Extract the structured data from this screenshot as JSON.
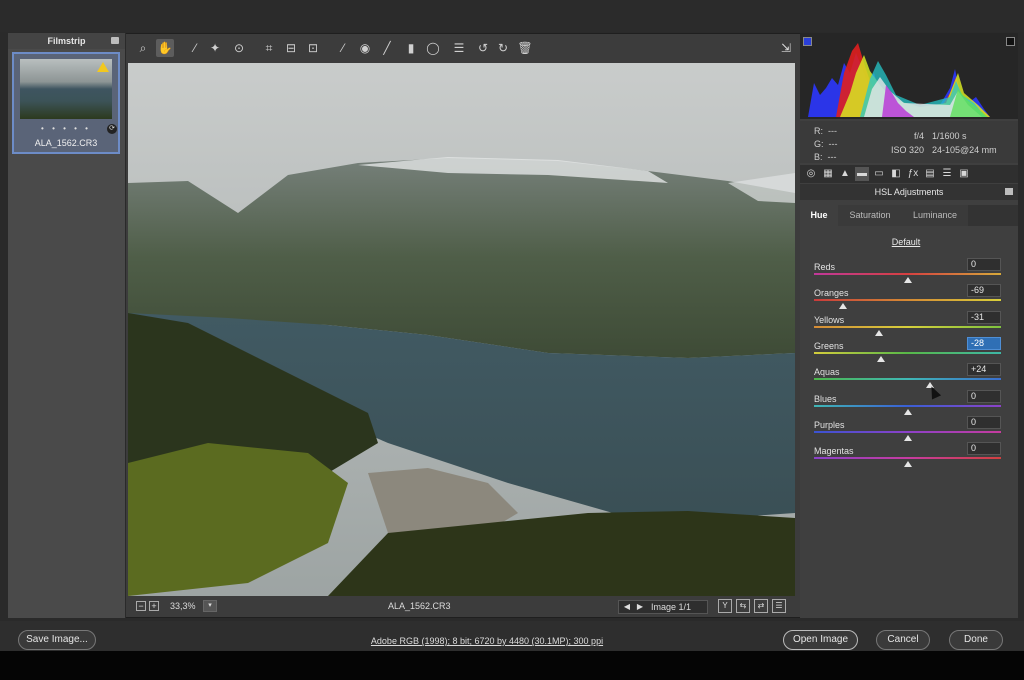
{
  "filmstrip": {
    "title": "Filmstrip",
    "thumbnail": {
      "filename": "ALA_1562.CR3",
      "rating_dots": "• • • • •"
    }
  },
  "toolbar": {
    "tools": [
      {
        "name": "zoom-tool-icon",
        "glyph": "⌕"
      },
      {
        "name": "hand-tool-icon",
        "glyph": "✋"
      },
      {
        "name": "white-balance-tool-icon",
        "glyph": "⁄"
      },
      {
        "name": "color-sampler-tool-icon",
        "glyph": "✦"
      },
      {
        "name": "targeted-adjustment-tool-icon",
        "glyph": "⊙"
      },
      {
        "name": "crop-tool-icon",
        "glyph": "⌗"
      },
      {
        "name": "straighten-tool-icon",
        "glyph": "⊟"
      },
      {
        "name": "transform-tool-icon",
        "glyph": "⊡"
      },
      {
        "name": "spot-removal-tool-icon",
        "glyph": "⁄"
      },
      {
        "name": "red-eye-tool-icon",
        "glyph": "◉"
      },
      {
        "name": "adjustment-brush-icon",
        "glyph": "╱"
      },
      {
        "name": "graduated-filter-icon",
        "glyph": "▮"
      },
      {
        "name": "radial-filter-icon",
        "glyph": "◯"
      },
      {
        "name": "preferences-icon",
        "glyph": "☰"
      },
      {
        "name": "rotate-left-icon",
        "glyph": "↺"
      },
      {
        "name": "rotate-right-icon",
        "glyph": "↻"
      },
      {
        "name": "trash-icon",
        "glyph": "🗑"
      }
    ],
    "export_glyph": "⇲"
  },
  "preview_bar": {
    "zoom_out": "−",
    "zoom_in": "+",
    "zoom_level": "33,3%",
    "zoom_dropdown": "▾",
    "filename": "ALA_1562.CR3",
    "prev": "◀",
    "next": "▶",
    "image_count": "Image 1/1",
    "view_icons": [
      "Y",
      "⇆",
      "⇄",
      "☰"
    ]
  },
  "info": {
    "r_label": "R:",
    "r_value": "---",
    "g_label": "G:",
    "g_value": "---",
    "b_label": "B:",
    "b_value": "---",
    "aperture": "f/4",
    "shutter": "1/1600 s",
    "iso": "ISO 320",
    "lens": "24-105@24 mm"
  },
  "panel": {
    "title": "HSL Adjustments",
    "panel_icons": [
      "◎",
      "▦",
      "▲",
      "▬",
      "▭",
      "◧",
      "ƒx",
      "▤",
      "☰",
      "▣"
    ],
    "subtabs": [
      "Hue",
      "Saturation",
      "Luminance"
    ],
    "active_subtab": "Hue",
    "default_link": "Default",
    "sliders": [
      {
        "label": "Reds",
        "value": "0",
        "num": 0,
        "gradient": "linear-gradient(90deg,#c0389a,#d64040,#d7a93a)"
      },
      {
        "label": "Oranges",
        "value": "-69",
        "num": -69,
        "gradient": "linear-gradient(90deg,#c93b3b,#d58a34,#d8cf3a)"
      },
      {
        "label": "Yellows",
        "value": "-31",
        "num": -31,
        "gradient": "linear-gradient(90deg,#d58b36,#d6cf3c,#7fc43e)"
      },
      {
        "label": "Greens",
        "value": "-28",
        "num": -28,
        "gradient": "linear-gradient(90deg,#d3cd3c,#58b848,#3eb7a6)"
      },
      {
        "label": "Aquas",
        "value": "+24",
        "num": 24,
        "gradient": "linear-gradient(90deg,#4cb84a,#3fb8b5,#3a6fd0)"
      },
      {
        "label": "Blues",
        "value": "0",
        "num": 0,
        "gradient": "linear-gradient(90deg,#3fb7b5,#3a5fd5,#8c42c9)"
      },
      {
        "label": "Purples",
        "value": "0",
        "num": 0,
        "gradient": "linear-gradient(90deg,#3a53d2,#8c41c9,#c63c9e)"
      },
      {
        "label": "Magentas",
        "value": "0",
        "num": 0,
        "gradient": "linear-gradient(90deg,#8a41c9,#c63ca1,#d24040)"
      }
    ],
    "selected_slider": "Greens"
  },
  "footer": {
    "save": "Save Image...",
    "workflow": "Adobe RGB (1998); 8 bit; 6720 by 4480 (30.1MP); 300 ppi",
    "open": "Open Image",
    "cancel": "Cancel",
    "done": "Done"
  },
  "colors": {
    "selection_blue": "#2f6fb5",
    "warning_yellow": "#f2c81f",
    "thumb_border": "#6d8cc7"
  }
}
